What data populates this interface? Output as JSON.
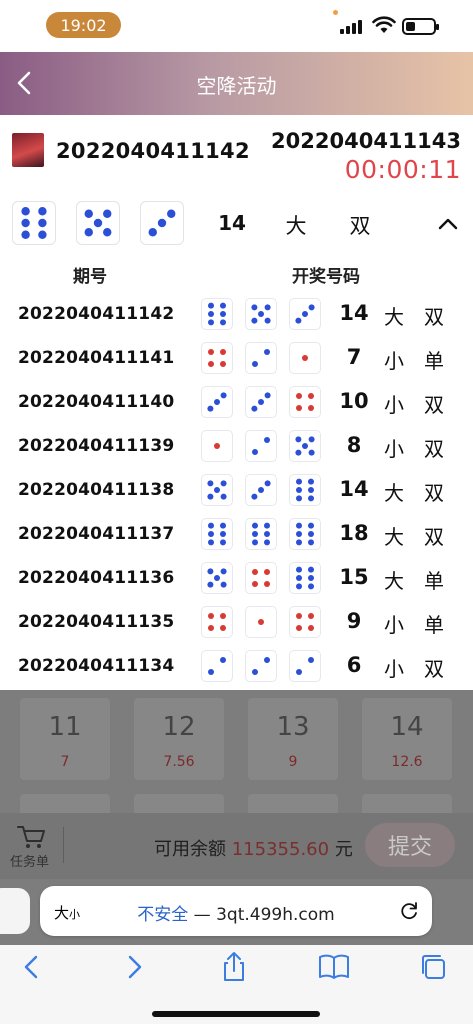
{
  "status_bar": {
    "time": "19:02"
  },
  "header": {
    "title": "空降活动"
  },
  "current": {
    "period": "2022040411142",
    "next_period": "2022040411143",
    "countdown": "00:00:11"
  },
  "latest": {
    "dice": [
      6,
      5,
      3
    ],
    "sum": "14",
    "size": "大",
    "parity": "双"
  },
  "table": {
    "col_period": "期号",
    "col_numbers": "开奖号码"
  },
  "history": [
    {
      "period": "2022040411142",
      "dice": [
        6,
        5,
        3
      ],
      "sum": "14",
      "size": "大",
      "parity": "双"
    },
    {
      "period": "2022040411141",
      "dice": [
        4,
        2,
        1
      ],
      "sum": "7",
      "size": "小",
      "parity": "单"
    },
    {
      "period": "2022040411140",
      "dice": [
        3,
        3,
        4
      ],
      "sum": "10",
      "size": "小",
      "parity": "双"
    },
    {
      "period": "2022040411139",
      "dice": [
        1,
        2,
        5
      ],
      "sum": "8",
      "size": "小",
      "parity": "双"
    },
    {
      "period": "2022040411138",
      "dice": [
        5,
        3,
        6
      ],
      "sum": "14",
      "size": "大",
      "parity": "双"
    },
    {
      "period": "2022040411137",
      "dice": [
        6,
        6,
        6
      ],
      "sum": "18",
      "size": "大",
      "parity": "双"
    },
    {
      "period": "2022040411136",
      "dice": [
        5,
        4,
        6
      ],
      "sum": "15",
      "size": "大",
      "parity": "单"
    },
    {
      "period": "2022040411135",
      "dice": [
        4,
        1,
        4
      ],
      "sum": "9",
      "size": "小",
      "parity": "单"
    },
    {
      "period": "2022040411134",
      "dice": [
        2,
        2,
        2
      ],
      "sum": "6",
      "size": "小",
      "parity": "双"
    }
  ],
  "bet_tiles": [
    {
      "number": "11",
      "odds": "7"
    },
    {
      "number": "12",
      "odds": "7.56"
    },
    {
      "number": "13",
      "odds": "9"
    },
    {
      "number": "14",
      "odds": "12.6"
    }
  ],
  "bottom": {
    "cart_label": "任务单",
    "balance_label": "可用余额",
    "balance_value": "115355.60",
    "balance_unit": "元",
    "submit_label": "提交"
  },
  "browser": {
    "aa_big": "大",
    "aa_small": "小",
    "insecure_label": "不安全",
    "separator": " — ",
    "domain": "3qt.499h.com"
  },
  "colors": {
    "die_blue": "#2b4fd6",
    "die_red": "#d83a34",
    "countdown": "#e0454c",
    "header_start": "#8a5c84",
    "header_end": "#e7c3a6"
  }
}
